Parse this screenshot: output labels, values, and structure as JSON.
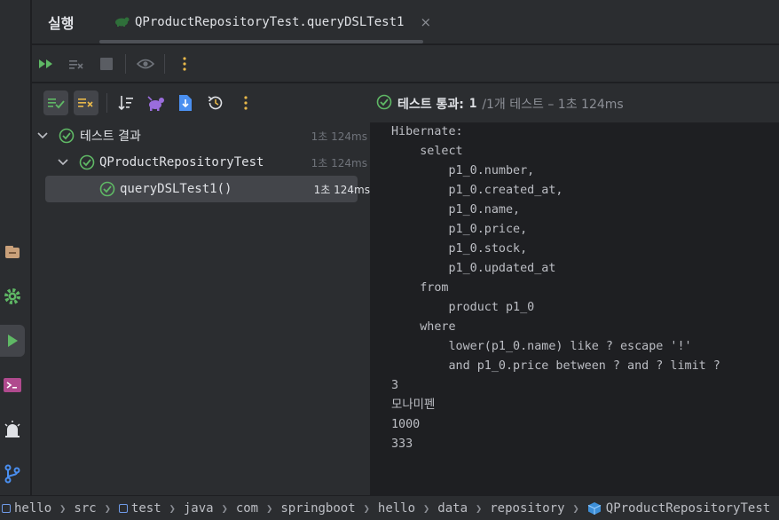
{
  "header": {
    "run_title": "실행",
    "tab_label": "QProductRepositoryTest.queryDSLTest1",
    "tab_close": "×"
  },
  "toolbar1": {
    "icons": [
      "rerun-icon",
      "stop-rerun-icon",
      "stop-icon",
      "eye-icon",
      "more-vertical-icon"
    ]
  },
  "toolbar2": {
    "icons": [
      "show-passed-icon",
      "show-ignored-icon",
      "sort-icon",
      "collapse-icon",
      "import-tests-icon",
      "history-icon",
      "more-vertical-icon"
    ],
    "status_text": "테스트 통과:",
    "status_count": "1",
    "status_detail": "/1개 테스트 – 1초 124ms"
  },
  "tree": {
    "rows": [
      {
        "label": "테스트 결과",
        "time": "1초 124ms"
      },
      {
        "label": "QProductRepositoryTest",
        "time": "1초 124ms"
      },
      {
        "label": "queryDSLTest1()",
        "time": "1초 124ms"
      }
    ]
  },
  "console": {
    "lines": [
      "Hibernate:",
      "    select",
      "        p1_0.number,",
      "        p1_0.created_at,",
      "        p1_0.name,",
      "        p1_0.price,",
      "        p1_0.stock,",
      "        p1_0.updated_at",
      "    from",
      "        product p1_0",
      "    where",
      "        lower(p1_0.name) like ? escape '!'",
      "        and p1_0.price between ? and ? limit ?",
      "3",
      "모나미펜",
      "1000",
      "333"
    ]
  },
  "breadcrumb": {
    "items": [
      "hello",
      "src",
      "test",
      "java",
      "com",
      "springboot",
      "hello",
      "data",
      "repository",
      "QProductRepositoryTest"
    ]
  },
  "colors": {
    "success": "#5fb865",
    "accent_purple": "#9a6ddc",
    "accent_yellow": "#e8b84a",
    "accent_blue": "#4a8ff0"
  }
}
